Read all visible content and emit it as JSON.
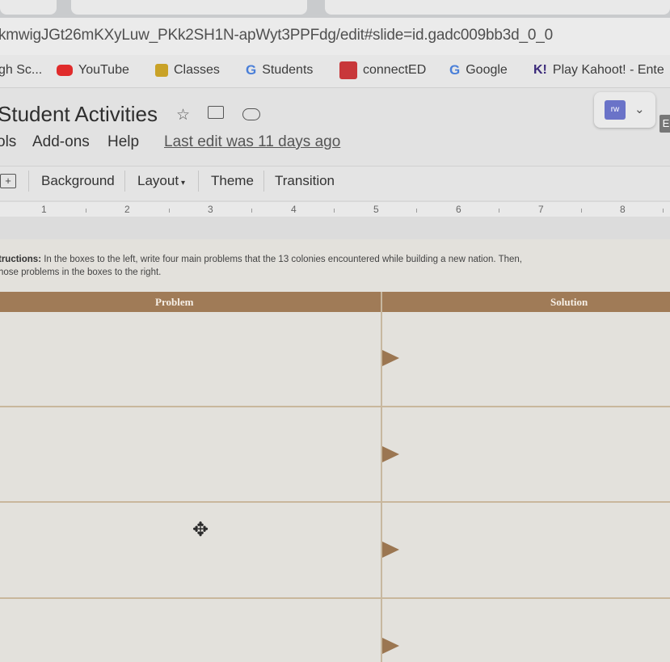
{
  "browser": {
    "url": "kmwigJGt26mKXyLuw_PKk2SH1N-apWyt3PPFdg/edit#slide=id.gadc009bb3d_0_0",
    "bookmarks": [
      {
        "label": "gh Sc...",
        "icon": "school-icon"
      },
      {
        "label": "YouTube",
        "icon": "youtube-icon"
      },
      {
        "label": "Classes",
        "icon": "classroom-icon"
      },
      {
        "label": "Students",
        "icon": "google-icon"
      },
      {
        "label": "connectED",
        "icon": "connected-icon"
      },
      {
        "label": "Google",
        "icon": "google-icon"
      },
      {
        "label": "Play Kahoot! - Ente",
        "icon": "kahoot-icon"
      }
    ]
  },
  "app": {
    "title": "Student Activities",
    "menu": [
      "ols",
      "Add-ons",
      "Help"
    ],
    "last_edit": "Last edit was 11 days ago",
    "addon_icon_text": "rw",
    "right_edge_icon_text": "E"
  },
  "toolbar": {
    "background": "Background",
    "layout": "Layout",
    "theme": "Theme",
    "transition": "Transition"
  },
  "ruler": {
    "numbers": [
      "1",
      "2",
      "3",
      "4",
      "5",
      "6",
      "7",
      "8"
    ]
  },
  "slide": {
    "instructions_label": "tructions:",
    "instructions_line1": " In the boxes to the left, write four main problems that the 13 colonies encountered while building a new nation. Then,",
    "instructions_line2": "hose problems in the boxes to the right.",
    "table": {
      "headers": [
        "Problem",
        "Solution"
      ],
      "rows": 4
    }
  },
  "colors": {
    "header_bar": "#a07b57",
    "arrow": "#9b7651",
    "slide_bg": "#e3e1dc"
  }
}
